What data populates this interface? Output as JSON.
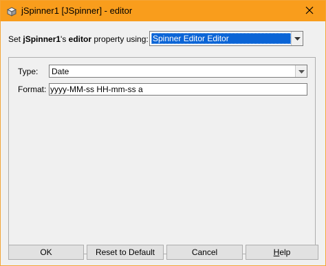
{
  "window": {
    "title": "jSpinner1 [JSpinner] - editor",
    "title_bar_color": "#f99d1c",
    "icon": "app-cube-icon",
    "close_icon": "close-icon"
  },
  "property_row": {
    "prefix": "Set ",
    "component": "jSpinner1",
    "possessive": "'s ",
    "property": "editor",
    "suffix": " property using:",
    "editor_select": {
      "selected": "Spinner Editor Editor",
      "highlight_color": "#0a64d6"
    }
  },
  "form": {
    "type_label": "Type:",
    "type_value": "Date",
    "format_label": "Format:",
    "format_value": "yyyy-MM-ss HH-mm-ss a"
  },
  "buttons": {
    "ok": "OK",
    "reset": "Reset to Default",
    "cancel": "Cancel",
    "help_mnemonic": "H",
    "help_rest": "elp"
  }
}
